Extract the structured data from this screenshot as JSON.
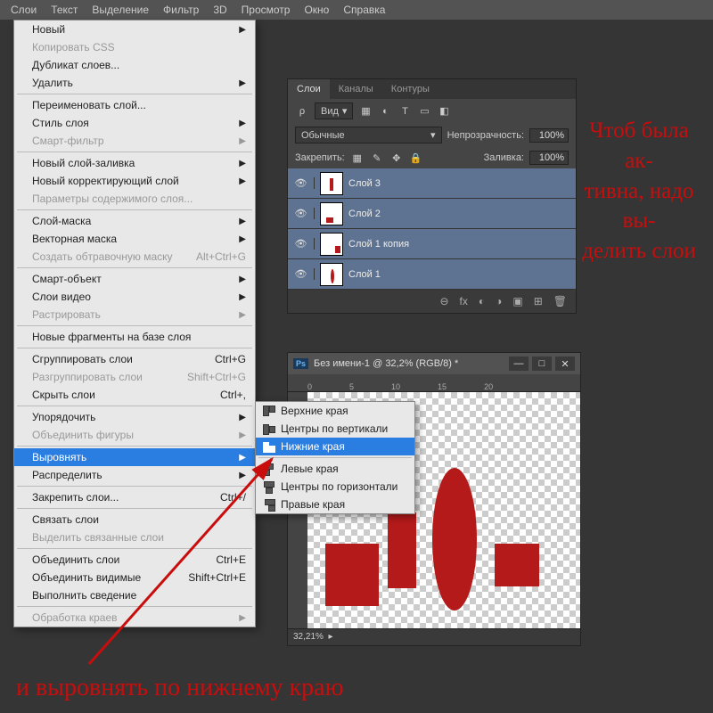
{
  "top_menu": [
    "Слои",
    "Текст",
    "Выделение",
    "Фильтр",
    "3D",
    "Просмотр",
    "Окно",
    "Справка"
  ],
  "layer_menu": {
    "items": [
      {
        "label": "Новый",
        "arrow": true
      },
      {
        "label": "Копировать CSS",
        "disabled": true
      },
      {
        "label": "Дубликат слоев..."
      },
      {
        "label": "Удалить",
        "arrow": true
      },
      {
        "sep": true
      },
      {
        "label": "Переименовать слой..."
      },
      {
        "label": "Стиль слоя",
        "arrow": true
      },
      {
        "label": "Смарт-фильтр",
        "disabled": true,
        "arrow": true
      },
      {
        "sep": true
      },
      {
        "label": "Новый слой-заливка",
        "arrow": true
      },
      {
        "label": "Новый корректирующий слой",
        "arrow": true
      },
      {
        "label": "Параметры содержимого слоя...",
        "disabled": true
      },
      {
        "sep": true
      },
      {
        "label": "Слой-маска",
        "arrow": true
      },
      {
        "label": "Векторная маска",
        "arrow": true
      },
      {
        "label": "Создать обтравочную маску",
        "shortcut": "Alt+Ctrl+G",
        "disabled": true
      },
      {
        "sep": true
      },
      {
        "label": "Смарт-объект",
        "arrow": true
      },
      {
        "label": "Слои видео",
        "arrow": true
      },
      {
        "label": "Растрировать",
        "arrow": true,
        "disabled": true
      },
      {
        "sep": true
      },
      {
        "label": "Новые фрагменты на базе слоя"
      },
      {
        "sep": true
      },
      {
        "label": "Сгруппировать слои",
        "shortcut": "Ctrl+G"
      },
      {
        "label": "Разгруппировать слои",
        "shortcut": "Shift+Ctrl+G",
        "disabled": true
      },
      {
        "label": "Скрыть слои",
        "shortcut": "Ctrl+,"
      },
      {
        "sep": true
      },
      {
        "label": "Упорядочить",
        "arrow": true
      },
      {
        "label": "Объединить фигуры",
        "disabled": true,
        "arrow": true
      },
      {
        "sep": true
      },
      {
        "label": "Выровнять",
        "arrow": true,
        "hl": true
      },
      {
        "label": "Распределить",
        "arrow": true
      },
      {
        "sep": true
      },
      {
        "label": "Закрепить слои...",
        "shortcut": "Ctrl+/"
      },
      {
        "sep": true
      },
      {
        "label": "Связать слои"
      },
      {
        "label": "Выделить связанные слои",
        "disabled": true
      },
      {
        "sep": true
      },
      {
        "label": "Объединить слои",
        "shortcut": "Ctrl+E"
      },
      {
        "label": "Объединить видимые",
        "shortcut": "Shift+Ctrl+E"
      },
      {
        "label": "Выполнить сведение"
      },
      {
        "sep": true
      },
      {
        "label": "Обработка краев",
        "disabled": true,
        "arrow": true
      }
    ]
  },
  "align_submenu": [
    {
      "icon": "top",
      "label": "Верхние края"
    },
    {
      "icon": "vcenter",
      "label": "Центры по вертикали"
    },
    {
      "icon": "bottom",
      "label": "Нижние края",
      "hl": true
    },
    {
      "sep": true
    },
    {
      "icon": "left",
      "label": "Левые края"
    },
    {
      "icon": "hcenter",
      "label": "Центры по горизонтали"
    },
    {
      "icon": "right",
      "label": "Правые края"
    }
  ],
  "layers_panel": {
    "tabs": [
      "Слои",
      "Каналы",
      "Контуры"
    ],
    "filter_label": "Вид",
    "mode": "Обычные",
    "opacity_label": "Непрозрачность:",
    "opacity_value": "100%",
    "lock_label": "Закрепить:",
    "fill_label": "Заливка:",
    "fill_value": "100%",
    "layers": [
      {
        "name": "Слой 3"
      },
      {
        "name": "Слой 2"
      },
      {
        "name": "Слой 1 копия"
      },
      {
        "name": "Слой 1"
      }
    ],
    "bottom_icons": [
      "⊕",
      "fx",
      "◐",
      "◑",
      "▣",
      "⊞",
      "🗑"
    ]
  },
  "doc_window": {
    "title": "Без имени-1 @ 32,2% (RGB/8) *",
    "ruler_marks": [
      "0",
      "5",
      "10",
      "15",
      "20"
    ],
    "status": "32,21%"
  },
  "annotations": {
    "right": "Чтоб была ак-\nтивна, надо вы-\nделить слои",
    "bottom": "и выровнять по нижнему краю"
  }
}
